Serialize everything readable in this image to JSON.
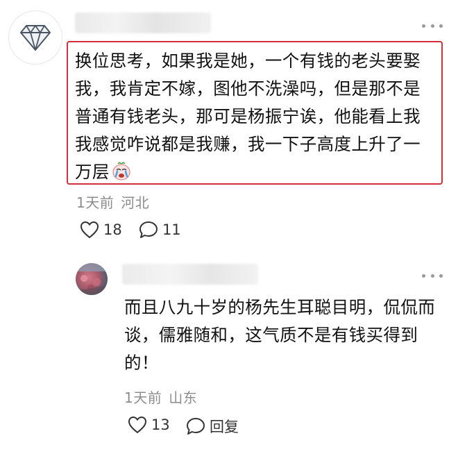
{
  "comment": {
    "avatar_icon": "diamond-icon",
    "text": "换位思考，如果我是她，一个有钱的老头要娶我，我肯定不嫁，图他不洗澡吗，但是那不是普通有钱老头，那可是杨振宁诶，他能看上我我感觉咋说都是我赚，我一下子高度上升了一万层",
    "emoji_icon": "crying-face-emoji",
    "time": "1天前",
    "location": "河北",
    "likes": "18",
    "replies": "11",
    "highlight_color": "#d32d3e"
  },
  "reply": {
    "text": "而且八九十岁的杨先生耳聪目明，侃侃而谈，儒雅随和，这气质不是有钱买得到的！",
    "time": "1天前",
    "location": "山东",
    "likes": "13",
    "reply_label": "回复"
  },
  "icons": {
    "like": "heart-outline-icon",
    "comment": "speech-bubble-icon",
    "more": "more-dots-icon"
  }
}
